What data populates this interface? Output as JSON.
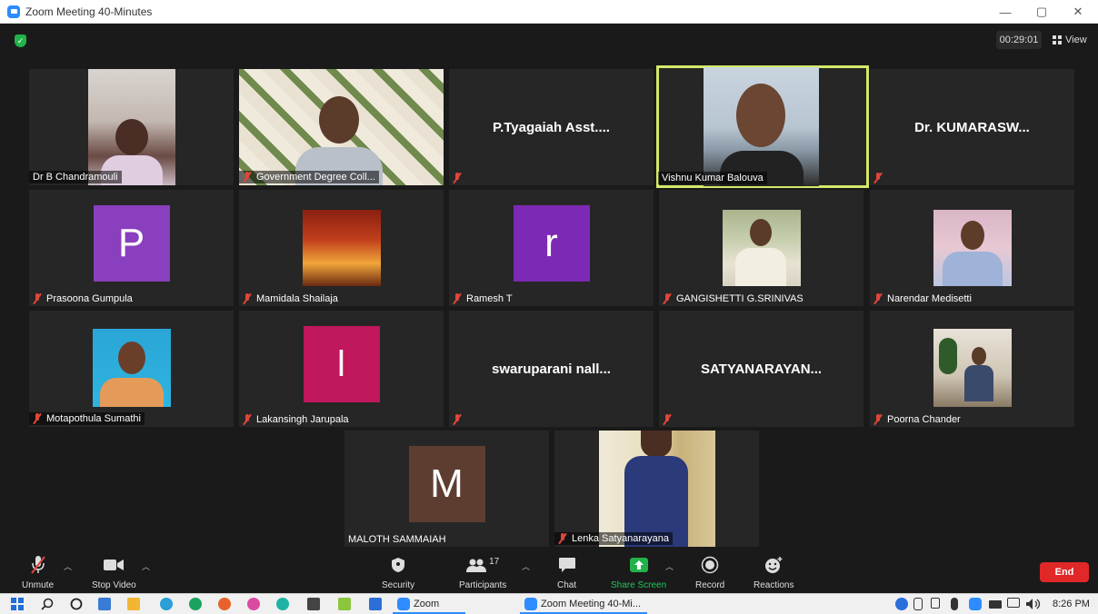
{
  "window": {
    "title": "Zoom Meeting 40-Minutes",
    "minimize": "—",
    "maximize": "▢",
    "close": "✕"
  },
  "header": {
    "timer": "00:29:01",
    "view_label": "View"
  },
  "participants": [
    {
      "name": "Dr B Chandramouli",
      "muted": false,
      "kind": "video"
    },
    {
      "name": "Government Degree Coll...",
      "muted": true,
      "kind": "video"
    },
    {
      "name": "",
      "display": "P.Tyagaiah Asst....",
      "muted": true,
      "kind": "name"
    },
    {
      "name": "Vishnu Kumar Balouva",
      "muted": false,
      "kind": "video",
      "active": true
    },
    {
      "name": "",
      "display": "Dr. KUMARASW...",
      "muted": true,
      "kind": "name"
    },
    {
      "name": "Prasoona Gumpula",
      "muted": true,
      "kind": "avatar",
      "letter": "P",
      "color": "#8a3fbf"
    },
    {
      "name": "Mamidala Shailaja",
      "muted": true,
      "kind": "photo"
    },
    {
      "name": "Ramesh T",
      "muted": true,
      "kind": "avatar",
      "letter": "r",
      "color": "#7c2ab5"
    },
    {
      "name": "GANGISHETTI G.SRINIVAS",
      "muted": true,
      "kind": "photo"
    },
    {
      "name": "Narendar Medisetti",
      "muted": true,
      "kind": "photo"
    },
    {
      "name": "Motapothula Sumathi",
      "muted": true,
      "kind": "photo"
    },
    {
      "name": "Lakansingh Jarupala",
      "muted": true,
      "kind": "avatar",
      "letter": "l",
      "color": "#c0175d"
    },
    {
      "name": "",
      "display": "swaruparani nall...",
      "muted": true,
      "kind": "name"
    },
    {
      "name": "",
      "display": "SATYANARAYAN...",
      "muted": true,
      "kind": "name"
    },
    {
      "name": "Poorna Chander",
      "muted": true,
      "kind": "photo"
    },
    {
      "name": "MALOTH SAMMAIAH",
      "muted": false,
      "kind": "avatar",
      "letter": "M",
      "color": "#5e3d31"
    },
    {
      "name": "Lenka Satyanarayana",
      "muted": true,
      "kind": "video"
    }
  ],
  "toolbar": {
    "unmute": "Unmute",
    "stop_video": "Stop Video",
    "security": "Security",
    "participants": "Participants",
    "participants_count": "17",
    "chat": "Chat",
    "share_screen": "Share Screen",
    "record": "Record",
    "reactions": "Reactions",
    "end": "End"
  },
  "taskbar": {
    "zoom_app": "Zoom",
    "meeting_window": "Zoom Meeting 40-Mi...",
    "time": "8:26 PM"
  },
  "colors": {
    "accent": "#2d8cff",
    "active_speaker": "#d5e86a",
    "end_red": "#e02828",
    "share_green": "#22b24c"
  }
}
